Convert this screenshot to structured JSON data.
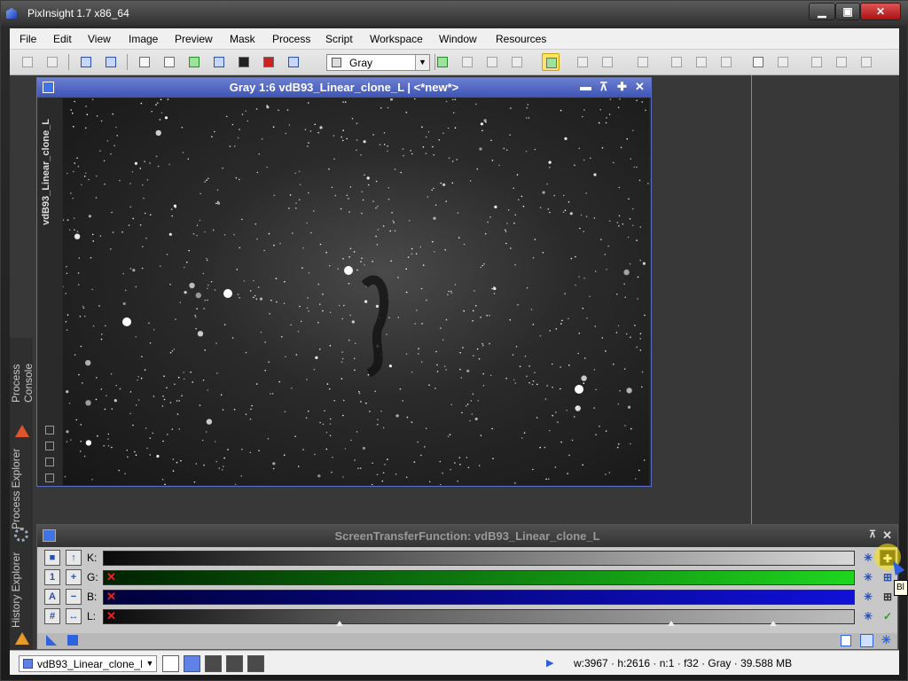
{
  "app": {
    "title": "PixInsight 1.7 x86_64"
  },
  "window_controls": {
    "minimize": "▁",
    "maximize": "▣",
    "close": "✕"
  },
  "menu": [
    "File",
    "Edit",
    "View",
    "Image",
    "Preview",
    "Mask",
    "Process",
    "Script",
    "Workspace",
    "Window",
    "Resources"
  ],
  "toolbar": {
    "combo_value": "Gray",
    "combo_icon": "gray-square-icon",
    "icons": [
      "undo-icon",
      "redo-icon",
      "zoom-1-1-icon",
      "zoom-fit-icon",
      "new-window-icon",
      "duplicate-icon",
      "new-image-icon",
      "channel-icon",
      "stf-icon",
      "mask-icon",
      "process-icon",
      "display-channel-icon",
      "new-preview-icon",
      "edit-preview-icon",
      "store-preview-icon",
      "restore-preview-icon",
      "prev-icon",
      "next-icon",
      "readout-icon",
      "view-icon",
      "select-icon",
      "preview-icon",
      "align-icon",
      "distribute-icon",
      "script-icon",
      "script2-icon",
      "script3-icon"
    ]
  },
  "image_window": {
    "title": "Gray 1:6 vdB93_Linear_clone_L | <*new*>",
    "side_label": "vdB93_Linear_clone_L",
    "controls": [
      "▬",
      "⊼",
      "✚",
      "✕"
    ]
  },
  "left_tabs": {
    "process_console": "Process Console",
    "process_explorer": "Process Explorer",
    "history_explorer": "History Explorer"
  },
  "stf_panel": {
    "title": "ScreenTransferFunction: vdB93_Linear_clone_L",
    "channels": [
      {
        "label": "K:",
        "colors": [
          "#0a0a0a",
          "#d8d8d8"
        ],
        "disabled": false
      },
      {
        "label": "G:",
        "colors": [
          "#002200",
          "#1ed61e"
        ],
        "disabled": true
      },
      {
        "label": "B:",
        "colors": [
          "#00003a",
          "#1010d8"
        ],
        "disabled": true
      },
      {
        "label": "L:",
        "colors": [
          "#0a0a0a",
          "#cfcfcf"
        ],
        "disabled": true
      }
    ],
    "l_markers": [
      0.315,
      0.757,
      0.892
    ]
  },
  "tooltip": {
    "text": "Bl"
  },
  "status": {
    "view": "vdB93_Linear_clone_L",
    "info": "w:3967 · h:2616 · n:1 · f32 · Gray · 39.588 MB"
  }
}
